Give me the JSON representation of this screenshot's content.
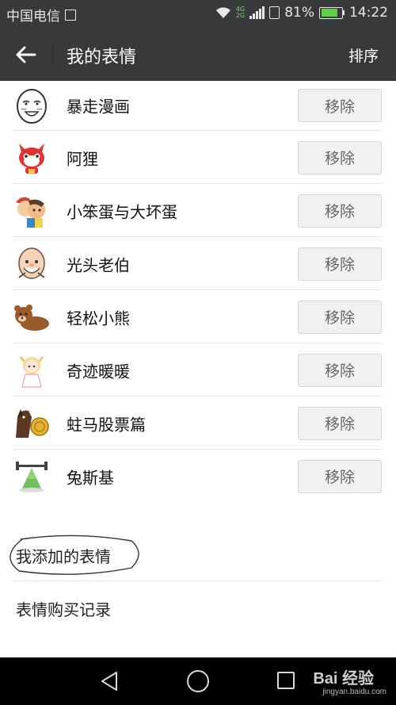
{
  "status_bar": {
    "carrier": "中国电信",
    "battery": "81%",
    "time": "14:22",
    "net_top": "4G",
    "net_bottom": "2G"
  },
  "app_bar": {
    "title": "我的表情",
    "sort_label": "排序"
  },
  "stickers": [
    {
      "name": "暴走漫画",
      "button": "移除",
      "icon": "rage-comic-face-icon"
    },
    {
      "name": "阿狸",
      "button": "移除",
      "icon": "red-fox-icon"
    },
    {
      "name": "小笨蛋与大坏蛋",
      "button": "移除",
      "icon": "cartoon-couple-icon"
    },
    {
      "name": "光头老伯",
      "button": "移除",
      "icon": "bald-old-man-icon"
    },
    {
      "name": "轻松小熊",
      "button": "移除",
      "icon": "relax-bear-icon"
    },
    {
      "name": "奇迹暖暖",
      "button": "移除",
      "icon": "anime-girl-icon"
    },
    {
      "name": "蛀马股票篇",
      "button": "移除",
      "icon": "horse-with-coin-icon"
    },
    {
      "name": "兔斯基",
      "button": "移除",
      "icon": "green-bunny-icon"
    }
  ],
  "sections": {
    "added": "我添加的表情",
    "purchase_history": "表情购买记录"
  },
  "watermark": {
    "brand": "Bai 经验",
    "url": "jingyan.baidu.com"
  },
  "colors": {
    "toolbar_bg": "#37393b",
    "battery_green": "#5fce4b",
    "button_bg": "#f1f1f1"
  }
}
